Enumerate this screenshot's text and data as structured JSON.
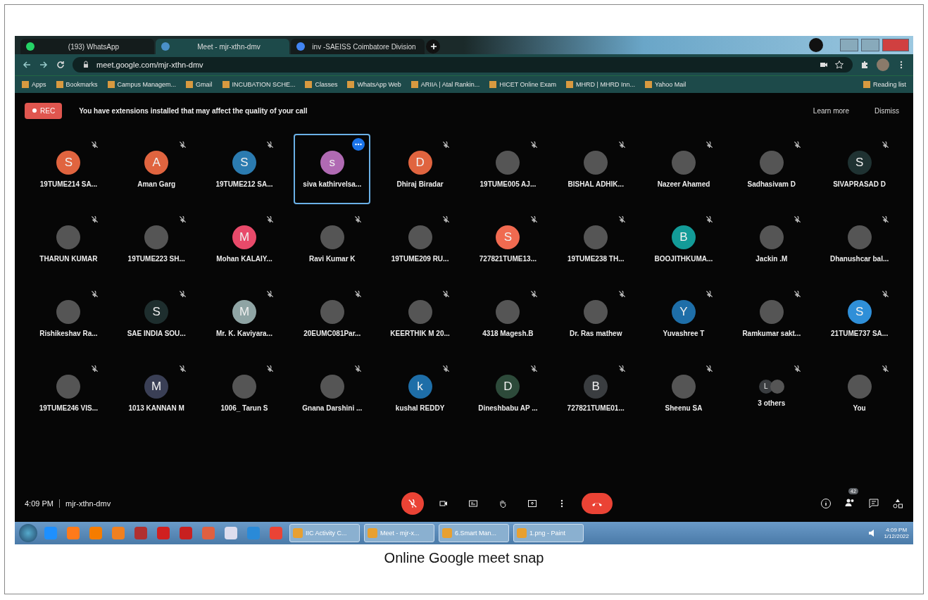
{
  "browser": {
    "tabs": [
      {
        "label": "(193) WhatsApp",
        "selected": false
      },
      {
        "label": "Meet - mjr-xthn-dmv",
        "selected": true
      },
      {
        "label": "inv -SAEISS Coimbatore Division",
        "selected": false
      }
    ],
    "address": "meet.google.com/mjr-xthn-dmv",
    "bookmarks": [
      "Apps",
      "Bookmarks",
      "Campus Managem...",
      "Gmail",
      "INCUBATION SCHE...",
      "Classes",
      "WhatsApp Web",
      "ARIIA | Atal Rankin...",
      "HICET Online Exam",
      "MHRD | MHRD Inn...",
      "Yahoo Mail"
    ],
    "reading_list": "Reading list"
  },
  "banner": {
    "rec": "REC",
    "message": "You have extensions installed that may affect the quality of your call",
    "learn_more": "Learn more",
    "dismiss": "Dismiss"
  },
  "tiles": [
    {
      "name": "19TUME214 SA...",
      "kind": "letter",
      "initial": "S",
      "color": "#e0643f",
      "selected": false
    },
    {
      "name": "Aman Garg",
      "kind": "letter",
      "initial": "A",
      "color": "#e0643f",
      "selected": false
    },
    {
      "name": "19TUME212 SA...",
      "kind": "letter",
      "initial": "S",
      "color": "#2b7bb0",
      "selected": false
    },
    {
      "name": "siva kathirvelsa...",
      "kind": "letter",
      "initial": "s",
      "color": "#b06ab3",
      "selected": true
    },
    {
      "name": "Dhiraj Biradar",
      "kind": "letter",
      "initial": "D",
      "color": "#e0643f",
      "selected": false
    },
    {
      "name": "19TUME005 AJ...",
      "kind": "photo",
      "selected": false
    },
    {
      "name": "BISHAL ADHIK...",
      "kind": "photo",
      "selected": false
    },
    {
      "name": "Nazeer Ahamed",
      "kind": "photo",
      "selected": false
    },
    {
      "name": "Sadhasivam D",
      "kind": "photo",
      "selected": false
    },
    {
      "name": "SIVAPRASAD D",
      "kind": "letter",
      "initial": "S",
      "color": "#1f3232",
      "selected": false
    },
    {
      "name": "THARUN KUMAR",
      "kind": "photo",
      "selected": false
    },
    {
      "name": "19TUME223 SH...",
      "kind": "photo",
      "selected": false
    },
    {
      "name": "Mohan KALAIY...",
      "kind": "letter",
      "initial": "M",
      "color": "#e84a6a",
      "selected": false
    },
    {
      "name": "Ravi Kumar K",
      "kind": "photo",
      "selected": false
    },
    {
      "name": "19TUME209 RU...",
      "kind": "photo",
      "selected": false
    },
    {
      "name": "727821TUME13...",
      "kind": "letter",
      "initial": "S",
      "color": "#f06a50",
      "selected": false
    },
    {
      "name": "19TUME238 TH...",
      "kind": "photo",
      "selected": false
    },
    {
      "name": "BOOJITHKUMA...",
      "kind": "letter",
      "initial": "B",
      "color": "#139b98",
      "selected": false
    },
    {
      "name": "Jackin .M",
      "kind": "photo",
      "selected": false
    },
    {
      "name": "Dhanushcar bal...",
      "kind": "photo",
      "selected": false
    },
    {
      "name": "Rishikeshav Ra...",
      "kind": "photo",
      "selected": false
    },
    {
      "name": "SAE INDIA SOU...",
      "kind": "letter",
      "initial": "S",
      "color": "#1e2e2e",
      "selected": false
    },
    {
      "name": "Mr. K. Kaviyara...",
      "kind": "letter",
      "initial": "M",
      "color": "#8fa4a4",
      "selected": false
    },
    {
      "name": "20EUMC081Par...",
      "kind": "photo",
      "selected": false
    },
    {
      "name": "KEERTHIK M 20...",
      "kind": "photo",
      "selected": false
    },
    {
      "name": "4318 Magesh.B",
      "kind": "photo",
      "selected": false
    },
    {
      "name": "Dr. Ras mathew",
      "kind": "photo",
      "selected": false
    },
    {
      "name": "Yuvashree T",
      "kind": "letter",
      "initial": "Y",
      "color": "#1e6ea8",
      "selected": false
    },
    {
      "name": "Ramkumar sakt...",
      "kind": "photo",
      "selected": false
    },
    {
      "name": "21TUME737 SA...",
      "kind": "letter",
      "initial": "S",
      "color": "#2f8fd8",
      "selected": false
    },
    {
      "name": "19TUME246 VIS...",
      "kind": "photo",
      "selected": false
    },
    {
      "name": "1013 KANNAN M",
      "kind": "letter",
      "initial": "M",
      "color": "#3a3f55",
      "selected": false
    },
    {
      "name": "1006_ Tarun S",
      "kind": "photo",
      "selected": false
    },
    {
      "name": "Gnana Darshini ...",
      "kind": "photo",
      "selected": false
    },
    {
      "name": "kushal REDDY",
      "kind": "letter",
      "initial": "k",
      "color": "#1e6ea8",
      "selected": false
    },
    {
      "name": "Dineshbabu AP ...",
      "kind": "letter",
      "initial": "D",
      "color": "#2d4a3a",
      "selected": false
    },
    {
      "name": "727821TUME01...",
      "kind": "letter",
      "initial": "B",
      "color": "#3a3d40",
      "selected": false
    },
    {
      "name": "Sheenu SA",
      "kind": "photo",
      "selected": false
    },
    {
      "name": "3 others",
      "kind": "group",
      "initial": "L",
      "color": "#3a3d40",
      "selected": false
    },
    {
      "name": "You",
      "kind": "photo",
      "selected": false
    }
  ],
  "meeting_bar": {
    "time": "4:09 PM",
    "code": "mjr-xthn-dmv",
    "people_count": "42"
  },
  "taskbar": {
    "windows": [
      "IIC Activity C...",
      "Meet - mjr-x...",
      "6.Smart Man...",
      "1.png - Paint"
    ],
    "time": "4:09 PM",
    "date": "1/12/2022"
  },
  "caption": "Online Google meet snap"
}
